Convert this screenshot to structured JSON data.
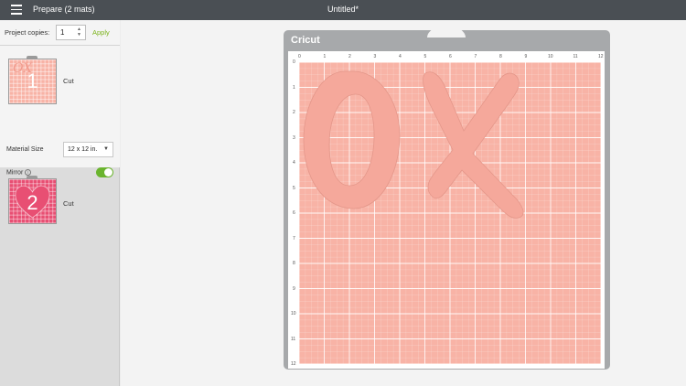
{
  "header": {
    "app_title": "Prepare (2 mats)",
    "doc_title": "Untitled*"
  },
  "project": {
    "copies_label": "Project copies:",
    "copies_value": "1",
    "apply_label": "Apply"
  },
  "mats": [
    {
      "number": "1",
      "label": "Cut",
      "color": "#f8b3a6"
    },
    {
      "number": "2",
      "label": "Cut",
      "color": "#e84f73"
    }
  ],
  "settings": {
    "material_size_label": "Material Size",
    "material_size_value": "12 x 12 in.",
    "mirror_label": "Mirror",
    "mirror_on": true
  },
  "canvas": {
    "brand": "Cricut",
    "ruler_top": [
      "0",
      "1",
      "2",
      "3",
      "4",
      "5",
      "6",
      "7",
      "8",
      "9",
      "10",
      "11",
      "12"
    ],
    "ruler_left": [
      "0",
      "1",
      "2",
      "3",
      "4",
      "5",
      "6",
      "7",
      "8",
      "9",
      "10",
      "11",
      "12"
    ],
    "mat_color": "#f8b3a6",
    "design_color": "#f5a89b"
  },
  "colors": {
    "accent_green": "#7bb31a",
    "topbar": "#4a4f54"
  }
}
